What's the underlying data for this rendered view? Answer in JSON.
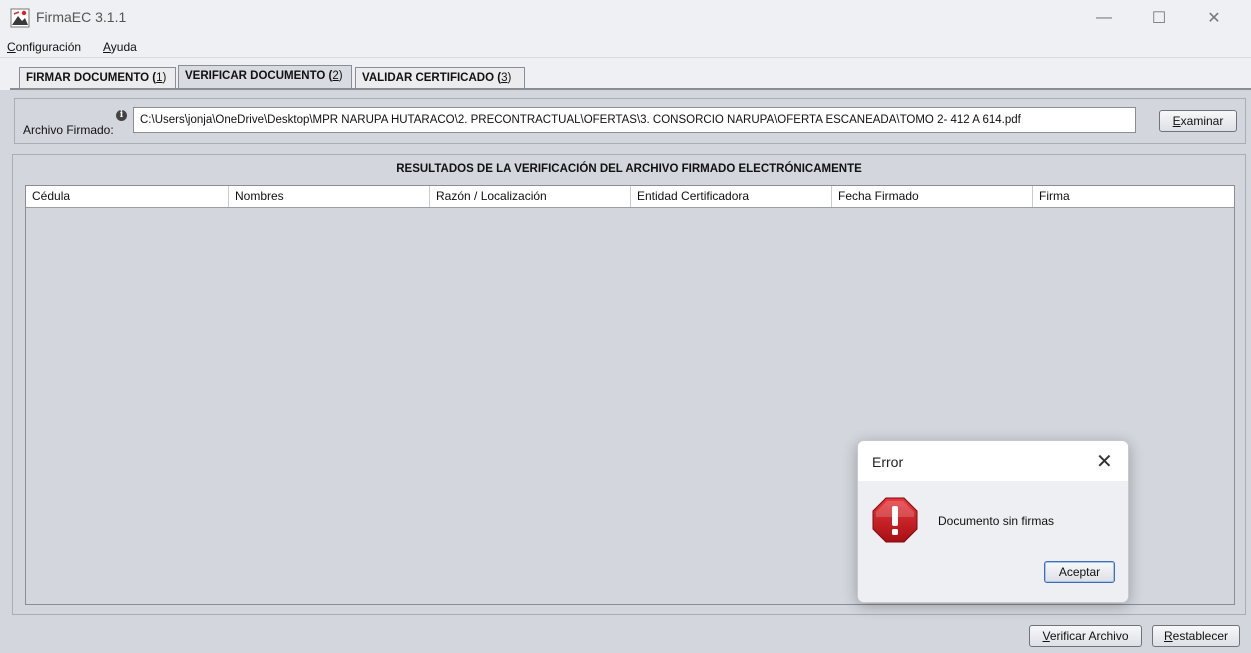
{
  "window": {
    "title": "FirmaEC 3.1.1",
    "minimize_glyph": "—",
    "maximize_glyph": "☐",
    "close_glyph": "✕"
  },
  "menu": {
    "items": [
      {
        "mnemonic": "C",
        "rest": "onfiguración"
      },
      {
        "mnemonic": "A",
        "rest": "yuda"
      }
    ]
  },
  "tabs": [
    {
      "label": "FIRMAR DOCUMENTO (",
      "mnemonic": "1",
      "close": ")",
      "active": false
    },
    {
      "label": "VERIFICAR DOCUMENTO (",
      "mnemonic": "2",
      "close": ")",
      "active": true
    },
    {
      "label": "VALIDAR CERTIFICADO (",
      "mnemonic": "3",
      "close": ")",
      "active": false
    }
  ],
  "file": {
    "label": "Archivo Firmado:",
    "info_glyph": "i",
    "value": "C:\\Users\\jonja\\OneDrive\\Desktop\\MPR NARUPA HUTARACO\\2. PRECONTRACTUAL\\OFERTAS\\3. CONSORCIO NARUPA\\OFERTA ESCANEADA\\TOMO 2- 412 A 614.pdf",
    "browse_mnemonic": "E",
    "browse_rest": "xaminar"
  },
  "results": {
    "title": "RESULTADOS DE LA VERIFICACIÓN DEL ARCHIVO FIRMADO ELECTRÓNICAMENTE",
    "columns": [
      "Cédula",
      "Nombres",
      "Razón / Localización",
      "Entidad Certificadora",
      "Fecha Firmado",
      "Firma"
    ]
  },
  "actions": {
    "verify_mnemonic": "V",
    "verify_rest": "erificar Archivo",
    "reset_mnemonic": "R",
    "reset_rest": "establecer"
  },
  "dialog": {
    "title": "Error",
    "close_glyph": "✕",
    "message": "Documento sin firmas",
    "ok_label": "Aceptar"
  },
  "colors": {
    "panel": "#d3d6dd",
    "error_icon": "#c8171e",
    "focus": "#3c6fb5"
  }
}
